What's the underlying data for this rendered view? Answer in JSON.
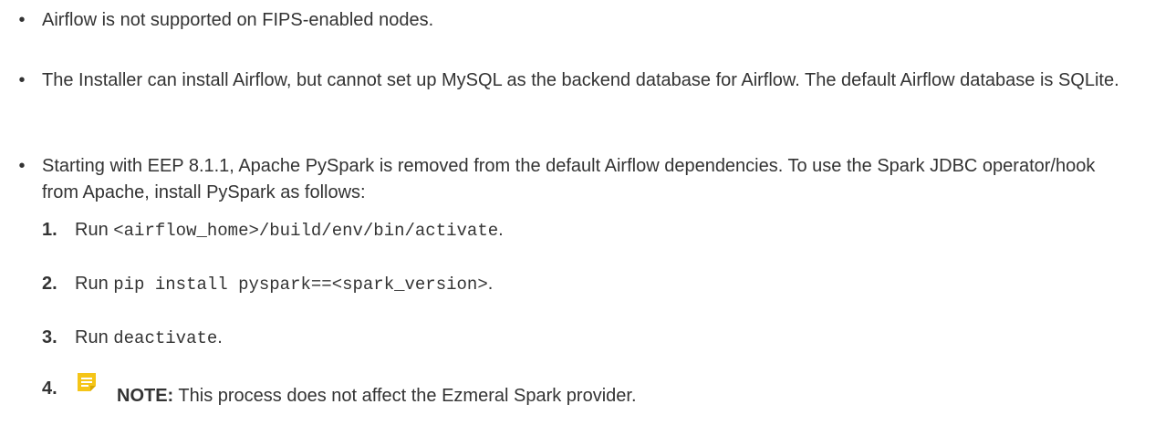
{
  "bullets": [
    {
      "text": "Airflow is not supported on FIPS-enabled nodes."
    },
    {
      "text": "The Installer can install Airflow, but cannot set up MySQL as the backend database for Airflow. The default Airflow database is SQLite."
    },
    {
      "text": "Starting with EEP 8.1.1, Apache PySpark is removed from the default Airflow dependencies. To use the Spark JDBC operator/hook from Apache, install PySpark as follows:"
    }
  ],
  "steps": [
    {
      "num": "1.",
      "prefix": "Run ",
      "code": "<airflow_home>/build/env/bin/activate",
      "suffix": "."
    },
    {
      "num": "2.",
      "prefix": "Run ",
      "code": "pip install pyspark==<spark_version>",
      "suffix": "."
    },
    {
      "num": "3.",
      "prefix": "Run ",
      "code": "deactivate",
      "suffix": "."
    }
  ],
  "note": {
    "num": "4.",
    "icon": "note-icon",
    "icon_color": "#f5c518",
    "label": "NOTE:",
    "text": " This process does not affect the Ezmeral Spark provider."
  }
}
